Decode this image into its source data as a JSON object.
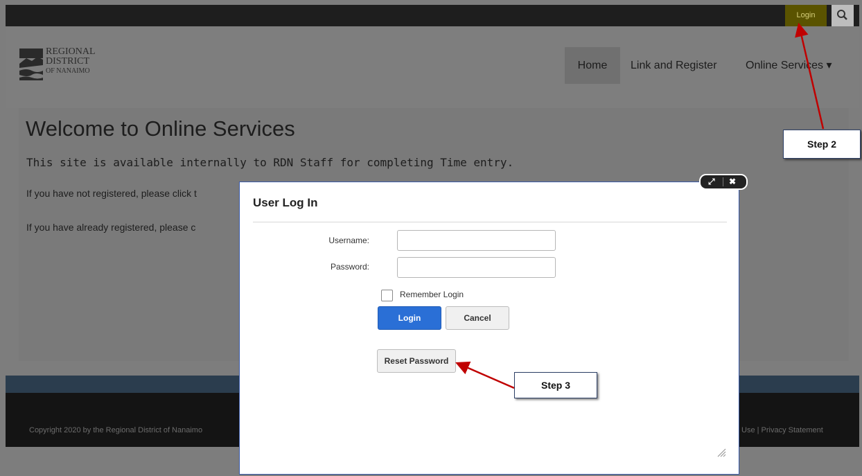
{
  "topbar": {
    "login_label": "Login",
    "search_icon": "search-icon"
  },
  "logo": {
    "line1": "REGIONAL",
    "line2": "DISTRICT",
    "line3": "OF NANAIMO"
  },
  "nav": {
    "home": "Home",
    "link_register": "Link and Register",
    "online_services": "Online Services ▾"
  },
  "main": {
    "title": "Welcome to Online Services",
    "subtitle": "This site is available internally to RDN Staff for completing Time entry.",
    "para1": "If you have not registered, please click t",
    "para2": "If you have already registered, please c"
  },
  "footer": {
    "left": "Copyright 2020 by the Regional District of Nanaimo",
    "right": "Use | Privacy Statement"
  },
  "dialog": {
    "title": "User Log In",
    "username_label": "Username:",
    "password_label": "Password:",
    "username_value": "",
    "password_value": "",
    "remember_label": "Remember Login",
    "login_button": "Login",
    "cancel_button": "Cancel",
    "reset_button": "Reset Password",
    "maximize_icon": "expand-icon",
    "close_icon": "close-icon"
  },
  "annotations": {
    "step2": "Step 2",
    "step3": "Step 3",
    "arrow_color": "#c00000"
  },
  "colors": {
    "primary_button": "#2a6fd6",
    "dialog_border": "#3a5aa8"
  }
}
